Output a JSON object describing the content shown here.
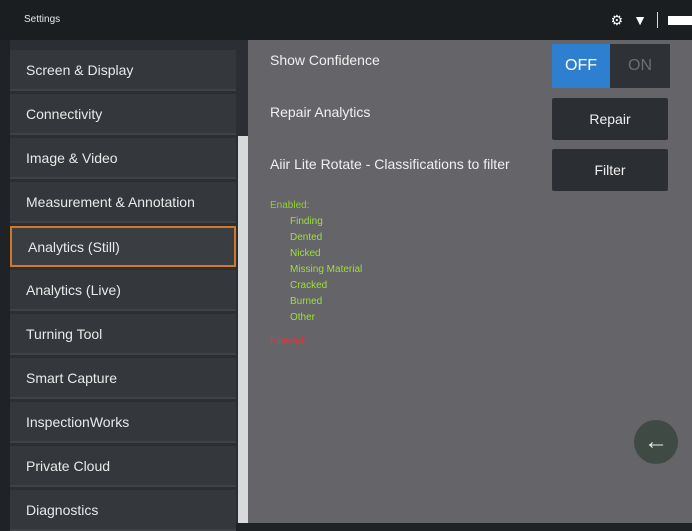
{
  "titlebar": {
    "title": "Settings",
    "icons": [
      "gear-icon",
      "wifi-icon",
      "battery-icon"
    ]
  },
  "sidebar": {
    "items": [
      {
        "label": "Screen & Display"
      },
      {
        "label": "Connectivity"
      },
      {
        "label": "Image & Video"
      },
      {
        "label": "Measurement & Annotation"
      },
      {
        "label": "Analytics (Still)"
      },
      {
        "label": "Analytics (Live)"
      },
      {
        "label": "Turning Tool"
      },
      {
        "label": "Smart Capture"
      },
      {
        "label": "InspectionWorks"
      },
      {
        "label": "Private Cloud"
      },
      {
        "label": "Diagnostics"
      }
    ],
    "active_index": 4
  },
  "content": {
    "show_confidence": {
      "label": "Show Confidence",
      "off": "OFF",
      "on": "ON",
      "value": "OFF"
    },
    "repair": {
      "label": "Repair Analytics",
      "button": "Repair"
    },
    "filter": {
      "label": "Aiir Lite Rotate - Classifications to filter",
      "button": "Filter"
    },
    "enabled_heading": "Enabled:",
    "enabled_items": [
      "Finding",
      "Dented",
      "Nicked",
      "Missing Material",
      "Cracked",
      "Burned",
      "Other"
    ],
    "filtered_heading": "Filtered:"
  },
  "colors": {
    "accent_blue": "#2f7fd0",
    "active_border": "#cf7a2a",
    "enabled_green": "#9be03a",
    "filtered_red": "#ff2b2b"
  }
}
